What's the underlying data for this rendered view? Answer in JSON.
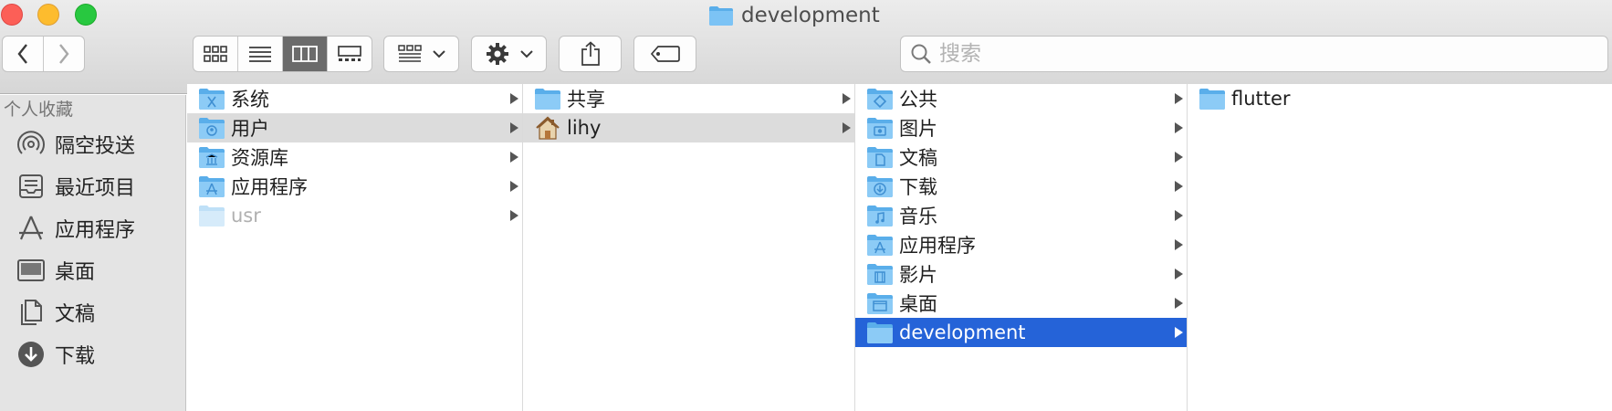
{
  "window": {
    "title": "development"
  },
  "toolbar": {
    "back_icon": "chevron-left-icon",
    "forward_icon": "chevron-right-icon",
    "view_modes": [
      "icon-view-icon",
      "list-view-icon",
      "column-view-icon",
      "gallery-view-icon"
    ],
    "active_view": "column",
    "group_icon": "group-by-icon",
    "action_icon": "gear-icon",
    "share_icon": "share-icon",
    "tag_icon": "tag-icon",
    "search_placeholder": "搜索"
  },
  "sidebar": {
    "section_title": "个人收藏",
    "items": [
      {
        "label": "隔空投送",
        "icon": "airdrop-icon"
      },
      {
        "label": "最近项目",
        "icon": "recents-icon"
      },
      {
        "label": "应用程序",
        "icon": "applications-icon"
      },
      {
        "label": "桌面",
        "icon": "desktop-icon"
      },
      {
        "label": "文稿",
        "icon": "documents-icon"
      },
      {
        "label": "下载",
        "icon": "downloads-icon"
      }
    ]
  },
  "columns": [
    {
      "items": [
        {
          "name": "系统",
          "icon": "system-folder-icon"
        },
        {
          "name": "用户",
          "icon": "users-folder-icon",
          "state": "highlighted"
        },
        {
          "name": "资源库",
          "icon": "library-folder-icon"
        },
        {
          "name": "应用程序",
          "icon": "applications-folder-icon"
        },
        {
          "name": "usr",
          "icon": "folder-icon",
          "state": "dimmed"
        }
      ]
    },
    {
      "items": [
        {
          "name": "共享",
          "icon": "folder-icon"
        },
        {
          "name": "lihy",
          "icon": "home-icon",
          "state": "highlighted"
        }
      ]
    },
    {
      "items": [
        {
          "name": "公共",
          "icon": "public-folder-icon"
        },
        {
          "name": "图片",
          "icon": "pictures-folder-icon"
        },
        {
          "name": "文稿",
          "icon": "documents-folder-icon"
        },
        {
          "name": "下载",
          "icon": "downloads-folder-icon"
        },
        {
          "name": "音乐",
          "icon": "music-folder-icon"
        },
        {
          "name": "应用程序",
          "icon": "applications-folder-icon"
        },
        {
          "name": "影片",
          "icon": "movies-folder-icon"
        },
        {
          "name": "桌面",
          "icon": "desktop-folder-icon"
        },
        {
          "name": "development",
          "icon": "folder-icon",
          "state": "selected"
        }
      ]
    },
    {
      "items": [
        {
          "name": "flutter",
          "icon": "folder-icon"
        }
      ]
    }
  ],
  "colors": {
    "selection": "#2563d8",
    "highlight": "#dcdcdc",
    "folder": "#6cb7ef"
  }
}
